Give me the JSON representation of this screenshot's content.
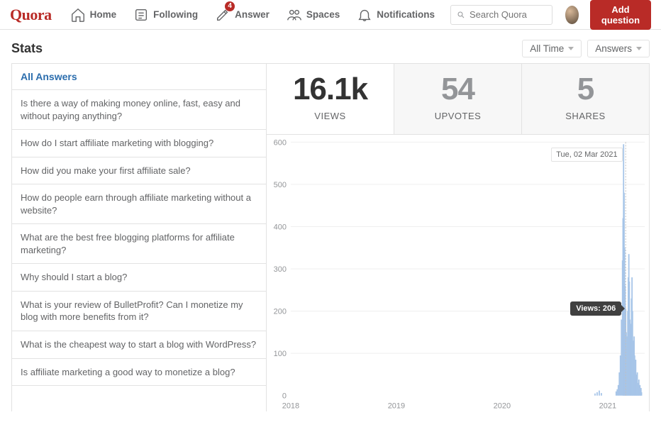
{
  "brand": "Quora",
  "nav": {
    "home": "Home",
    "following": "Following",
    "answer": "Answer",
    "answer_badge": "4",
    "spaces": "Spaces",
    "notifications": "Notifications"
  },
  "search": {
    "placeholder": "Search Quora"
  },
  "add_question": "Add question",
  "page_title": "Stats",
  "filters": {
    "time": "All Time",
    "type": "Answers"
  },
  "sidebar": {
    "header": "All Answers",
    "items": [
      "Is there a way of making money online, fast, easy and without paying anything?",
      "How do I start affiliate marketing with blogging?",
      "How did you make your first affiliate sale?",
      "How do people earn through affiliate marketing without a website?",
      "What are the best free blogging platforms for affiliate marketing?",
      "Why should I start a blog?",
      "What is your review of BulletProfit? Can I monetize my blog with more benefits from it?",
      "What is the cheapest way to start a blog with WordPress?",
      "Is affiliate marketing a good way to monetize a blog?"
    ]
  },
  "metrics": {
    "views": {
      "value": "16.1k",
      "label": "VIEWS"
    },
    "upvotes": {
      "value": "54",
      "label": "UPVOTES"
    },
    "shares": {
      "value": "5",
      "label": "SHARES"
    }
  },
  "tooltip": {
    "date_text": "Tue, 02 Mar 2021",
    "views_text": "Views: 206"
  },
  "chart_data": {
    "type": "bar",
    "title": "",
    "xlabel": "",
    "ylabel": "",
    "ylim": [
      0,
      600
    ],
    "y_ticks": [
      0,
      100,
      200,
      300,
      400,
      500,
      600
    ],
    "x_ticks": [
      "2018",
      "2019",
      "2020",
      "2021"
    ],
    "x_range_years": [
      2018,
      2021.35
    ],
    "highlight": {
      "date": "2021-03-02",
      "x_year": 2021.17,
      "value": 206
    },
    "series": [
      {
        "name": "Views",
        "color": "#a7c5e8",
        "points": [
          [
            2020.88,
            5
          ],
          [
            2020.9,
            8
          ],
          [
            2020.92,
            12
          ],
          [
            2020.94,
            6
          ],
          [
            2021.08,
            10
          ],
          [
            2021.09,
            15
          ],
          [
            2021.1,
            25
          ],
          [
            2021.11,
            55
          ],
          [
            2021.12,
            95
          ],
          [
            2021.13,
            180
          ],
          [
            2021.14,
            320
          ],
          [
            2021.145,
            420
          ],
          [
            2021.15,
            595
          ],
          [
            2021.155,
            480
          ],
          [
            2021.16,
            350
          ],
          [
            2021.165,
            260
          ],
          [
            2021.17,
            206
          ],
          [
            2021.175,
            150
          ],
          [
            2021.18,
            110
          ],
          [
            2021.185,
            140
          ],
          [
            2021.19,
            200
          ],
          [
            2021.195,
            280
          ],
          [
            2021.2,
            335
          ],
          [
            2021.205,
            270
          ],
          [
            2021.21,
            180
          ],
          [
            2021.215,
            120
          ],
          [
            2021.22,
            170
          ],
          [
            2021.225,
            230
          ],
          [
            2021.23,
            280
          ],
          [
            2021.235,
            200
          ],
          [
            2021.24,
            130
          ],
          [
            2021.245,
            90
          ],
          [
            2021.25,
            140
          ],
          [
            2021.255,
            95
          ],
          [
            2021.26,
            60
          ],
          [
            2021.265,
            85
          ],
          [
            2021.27,
            50
          ],
          [
            2021.275,
            35
          ],
          [
            2021.28,
            55
          ],
          [
            2021.285,
            30
          ],
          [
            2021.29,
            20
          ],
          [
            2021.295,
            38
          ],
          [
            2021.3,
            15
          ],
          [
            2021.305,
            25
          ],
          [
            2021.31,
            10
          ],
          [
            2021.315,
            18
          ],
          [
            2021.32,
            8
          ]
        ]
      }
    ]
  }
}
